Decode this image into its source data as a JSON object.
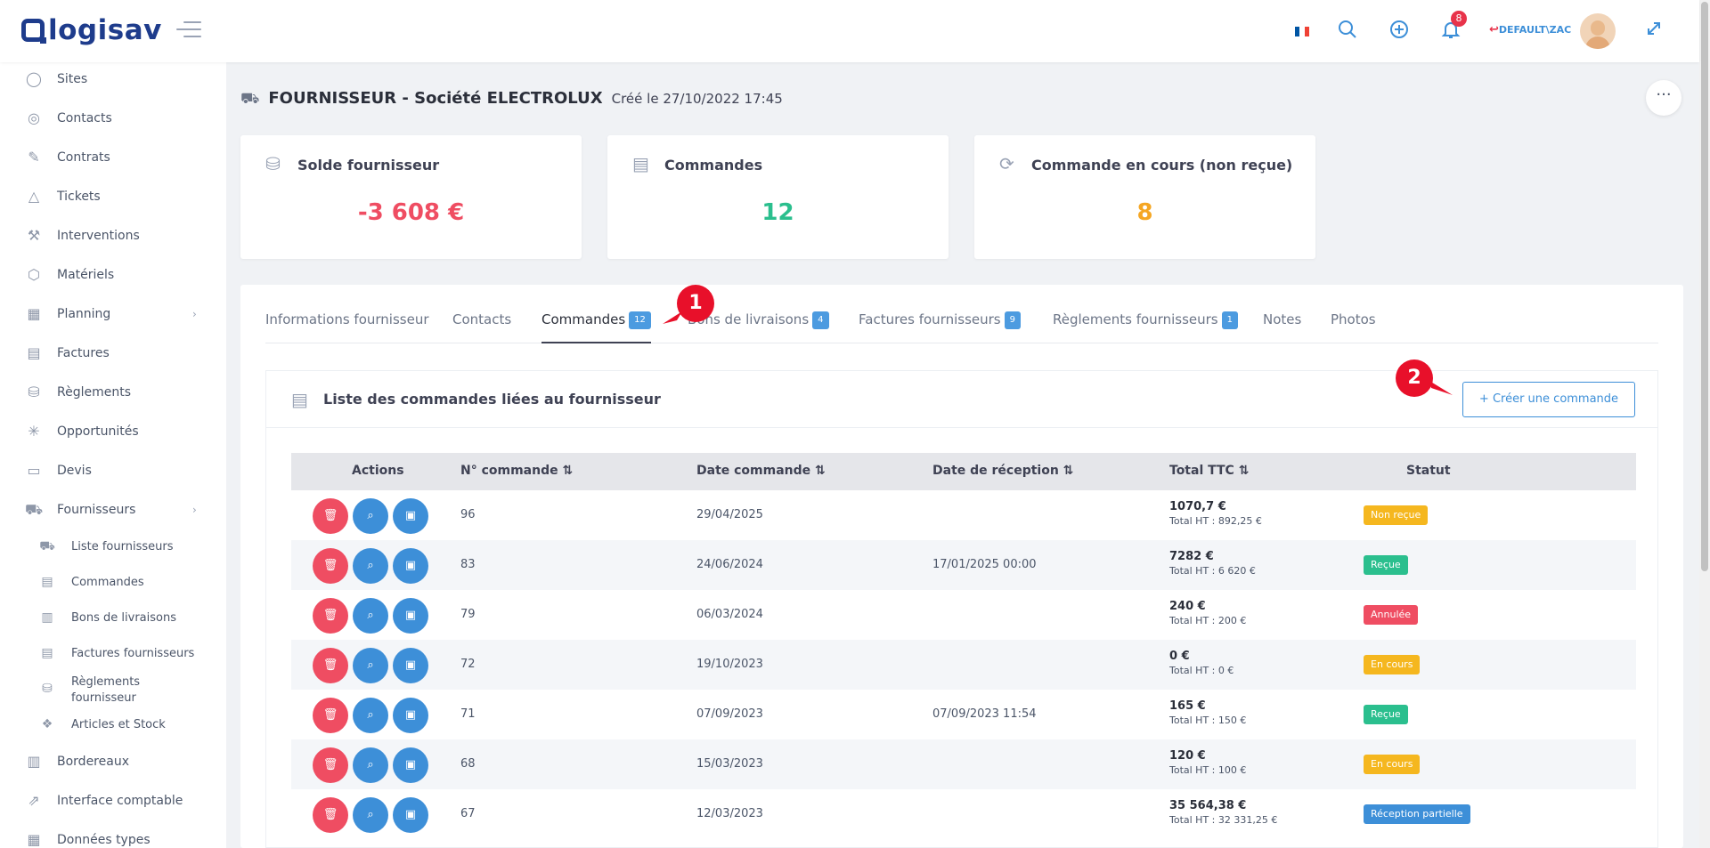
{
  "app": {
    "logo_text": "logisav"
  },
  "topbar": {
    "notifications_count": "8",
    "user_label": "DEFAULT\\ZAC",
    "flag_colors": [
      "#0055a4",
      "#ffffff",
      "#ef4135"
    ]
  },
  "sidebar": {
    "items": [
      {
        "label": "Sites",
        "icon": "user-icon"
      },
      {
        "label": "Contacts",
        "icon": "contact-icon"
      },
      {
        "label": "Contrats",
        "icon": "contract-icon"
      },
      {
        "label": "Tickets",
        "icon": "warning-icon"
      },
      {
        "label": "Interventions",
        "icon": "wrench-icon"
      },
      {
        "label": "Matériels",
        "icon": "box-icon"
      },
      {
        "label": "Planning",
        "icon": "calendar-icon"
      },
      {
        "label": "Factures",
        "icon": "document-icon"
      },
      {
        "label": "Règlements",
        "icon": "coins-icon"
      },
      {
        "label": "Opportunités",
        "icon": "network-icon"
      },
      {
        "label": "Devis",
        "icon": "folder-icon"
      },
      {
        "label": "Fournisseurs",
        "icon": "truck-icon"
      }
    ],
    "sub_items": [
      {
        "label": "Liste fournisseurs",
        "icon": "truck-icon"
      },
      {
        "label": "Commandes",
        "icon": "document-icon"
      },
      {
        "label": "Bons de livraisons",
        "icon": "clipboard-icon"
      },
      {
        "label": "Factures fournisseurs",
        "icon": "document-icon"
      },
      {
        "label": "Règlements fournisseur",
        "icon": "coins-icon"
      },
      {
        "label": "Articles et Stock",
        "icon": "dropbox-icon"
      }
    ],
    "bottom_items": [
      {
        "label": "Bordereaux",
        "icon": "clipboard-icon"
      },
      {
        "label": "Interface comptable",
        "icon": "external-icon"
      },
      {
        "label": "Données types",
        "icon": "grid-icon"
      }
    ]
  },
  "page": {
    "title": "FOURNISSEUR - Société ELECTROLUX",
    "created": "Créé le 27/10/2022 17:45"
  },
  "stats": [
    {
      "title": "Solde fournisseur",
      "value": "-3 608 €",
      "color": "#ef4d62"
    },
    {
      "title": "Commandes",
      "value": "12",
      "color": "#2bbf8e"
    },
    {
      "title": "Commande en cours (non reçue)",
      "value": "8",
      "color": "#f5a623"
    }
  ],
  "tabs": [
    {
      "label": "Informations fournisseur",
      "count": ""
    },
    {
      "label": "Contacts",
      "count": ""
    },
    {
      "label": "Commandes",
      "count": "12"
    },
    {
      "label": "Bons de livraisons",
      "count": "4"
    },
    {
      "label": "Factures fournisseurs",
      "count": "9"
    },
    {
      "label": "Règlements fournisseurs",
      "count": "1"
    },
    {
      "label": "Notes",
      "count": ""
    },
    {
      "label": "Photos",
      "count": ""
    }
  ],
  "callouts": [
    "1",
    "2"
  ],
  "list": {
    "title": "Liste des commandes liées au fournisseur",
    "create_button": "+ Créer une commande",
    "columns": [
      "Actions",
      "N° commande ⇅",
      "Date commande ⇅",
      "Date de réception ⇅",
      "Total TTC ⇅",
      "Statut"
    ],
    "rows": [
      {
        "num": "96",
        "date": "29/04/2025",
        "reception": "",
        "ttc": "1070,7 €",
        "ht": "Total HT : 892,25 €",
        "status": "Non reçue",
        "status_color": "#f5b71f"
      },
      {
        "num": "83",
        "date": "24/06/2024",
        "reception": "17/01/2025 00:00",
        "ttc": "7282 €",
        "ht": "Total HT : 6 620 €",
        "status": "Reçue",
        "status_color": "#2bbf8e"
      },
      {
        "num": "79",
        "date": "06/03/2024",
        "reception": "",
        "ttc": "240 €",
        "ht": "Total HT : 200 €",
        "status": "Annulée",
        "status_color": "#ef4d62"
      },
      {
        "num": "72",
        "date": "19/10/2023",
        "reception": "",
        "ttc": "0 €",
        "ht": "Total HT : 0 €",
        "status": "En cours",
        "status_color": "#f5b71f"
      },
      {
        "num": "71",
        "date": "07/09/2023",
        "reception": "07/09/2023 11:54",
        "ttc": "165 €",
        "ht": "Total HT : 150 €",
        "status": "Reçue",
        "status_color": "#2bbf8e"
      },
      {
        "num": "68",
        "date": "15/03/2023",
        "reception": "",
        "ttc": "120 €",
        "ht": "Total HT : 100 €",
        "status": "En cours",
        "status_color": "#f5b71f"
      },
      {
        "num": "67",
        "date": "12/03/2023",
        "reception": "",
        "ttc": "35 564,38 €",
        "ht": "Total HT : 32 331,25 €",
        "status": "Réception partielle",
        "status_color": "#3d8fd8"
      }
    ]
  }
}
